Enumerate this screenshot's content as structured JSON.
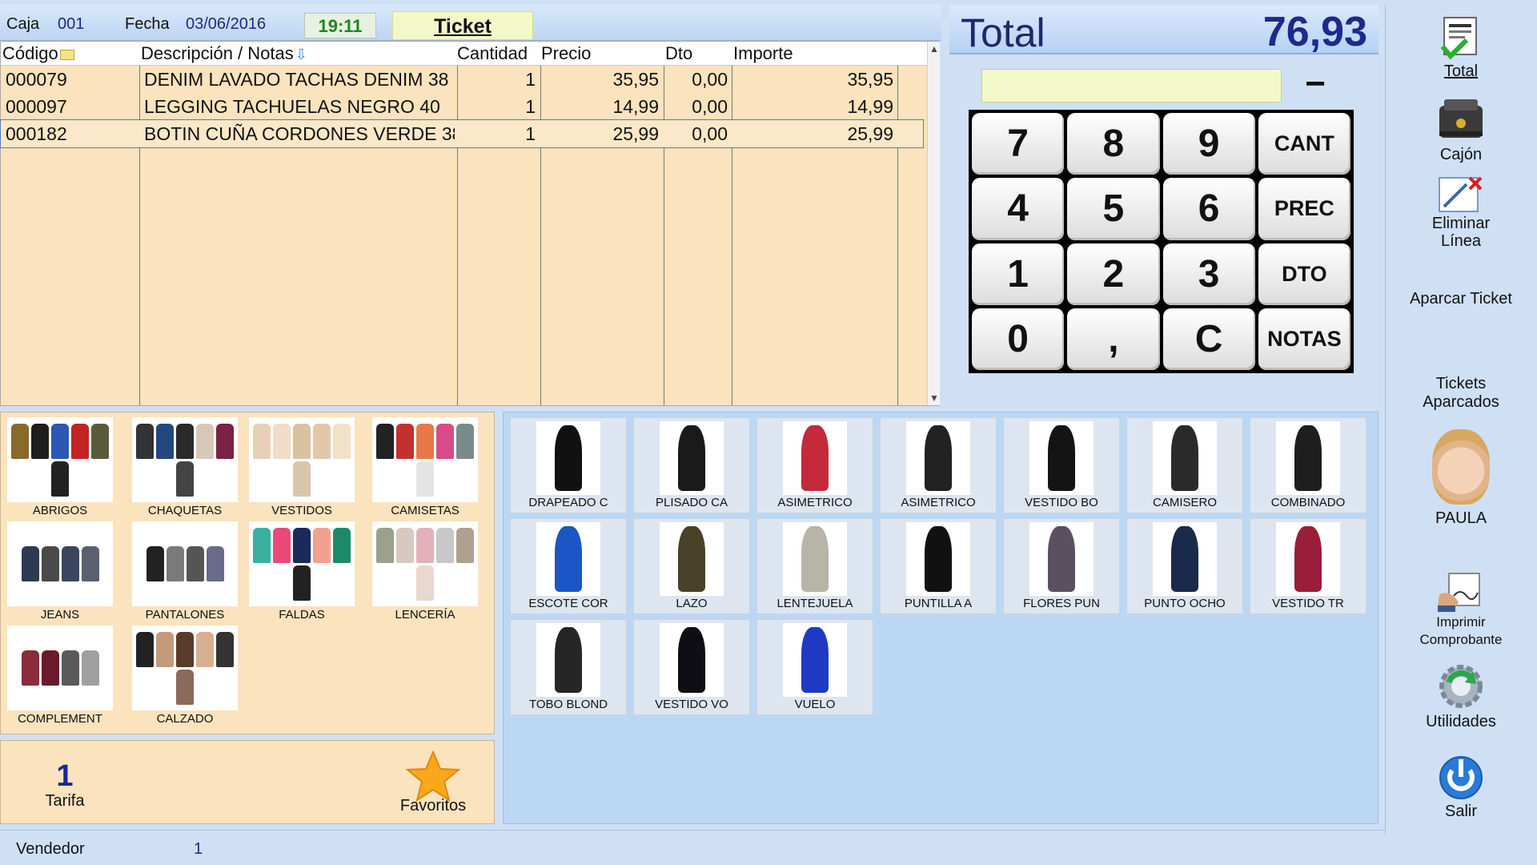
{
  "header": {
    "caja_label": "Caja",
    "caja_value": "001",
    "fecha_label": "Fecha",
    "fecha_value": "03/06/2016",
    "time": "19:11",
    "ticket_label": "Ticket"
  },
  "grid": {
    "columns": [
      "Código",
      "Descripción / Notas",
      "Cantidad",
      "Precio",
      "Dto",
      "Importe"
    ],
    "rows": [
      {
        "codigo": "000079",
        "descripcion": "DENIM LAVADO TACHAS DENIM 38",
        "cantidad": "1",
        "precio": "35,95",
        "dto": "0,00",
        "importe": "35,95"
      },
      {
        "codigo": "000097",
        "descripcion": "LEGGING TACHUELAS NEGRO 40",
        "cantidad": "1",
        "precio": "14,99",
        "dto": "0,00",
        "importe": "14,99"
      },
      {
        "codigo": "000182",
        "descripcion": "BOTIN CUÑA CORDONES VERDE 38",
        "cantidad": "1",
        "precio": "25,99",
        "dto": "0,00",
        "importe": "25,99"
      }
    ]
  },
  "total": {
    "label": "Total",
    "value": "76,93"
  },
  "keypad": {
    "minus": "−",
    "keys": [
      "7",
      "8",
      "9",
      "CANT",
      "4",
      "5",
      "6",
      "PREC",
      "1",
      "2",
      "3",
      "DTO",
      "0",
      ",",
      "C",
      "NOTAS"
    ]
  },
  "sidebar": {
    "total": "Total",
    "cajon": "Cajón",
    "eliminar_1": "Eliminar",
    "eliminar_2": "Línea",
    "aparcar": "Aparcar Ticket",
    "aparcados_1": "Tickets",
    "aparcados_2": "Aparcados",
    "user": "PAULA",
    "imprimir_1": "Imprimir",
    "imprimir_2": "Comprobante",
    "utilidades": "Utilidades",
    "salir": "Salir"
  },
  "categories": [
    {
      "label": "ABRIGOS",
      "colors": [
        "#8a6a2a",
        "#1e1e1e",
        "#2c57b4",
        "#c22424",
        "#5a5a3a",
        "#222"
      ]
    },
    {
      "label": "CHAQUETAS",
      "colors": [
        "#333",
        "#23477d",
        "#2a2a2a",
        "#d8c8b8",
        "#7a2244",
        "#444"
      ]
    },
    {
      "label": "VESTIDOS",
      "colors": [
        "#e8d0b8",
        "#f0dcc8",
        "#d9c2a0",
        "#e2c8a8",
        "#f1e1c9",
        "#d8c6a8"
      ]
    },
    {
      "label": "CAMISETAS",
      "colors": [
        "#222",
        "#c43030",
        "#e8774a",
        "#d84a8a",
        "#7a8a8a",
        "#e4e4e4"
      ]
    },
    {
      "label": "JEANS",
      "colors": [
        "#2e3a52",
        "#4a4a4a",
        "#3a4660",
        "#5a6070"
      ]
    },
    {
      "label": "PANTALONES",
      "colors": [
        "#222",
        "#7a7a7a",
        "#555",
        "#6a6a8a"
      ]
    },
    {
      "label": "FALDAS",
      "colors": [
        "#38b0a0",
        "#e84a7a",
        "#1a2a5a",
        "#f2a090",
        "#1a8a6a",
        "#222"
      ]
    },
    {
      "label": "LENCERÍA",
      "colors": [
        "#9aa08a",
        "#d8c8c0",
        "#e2b0b8",
        "#c8c8c8",
        "#b0a090",
        "#e8d8d0"
      ]
    },
    {
      "label": "COMPLEMENT",
      "colors": [
        "#8a2a3a",
        "#6a1a2a",
        "#5a5a5a",
        "#a0a0a0"
      ]
    },
    {
      "label": "CALZADO",
      "colors": [
        "#222",
        "#c49a7a",
        "#5a3a2a",
        "#d8b090",
        "#333",
        "#8a6a5a"
      ]
    }
  ],
  "products": [
    {
      "label": "DRAPEADO C",
      "color": "#111"
    },
    {
      "label": "PLISADO CA",
      "color": "#1a1a1a"
    },
    {
      "label": "ASIMETRICO",
      "color": "#c42a3a"
    },
    {
      "label": "ASIMETRICO",
      "color": "#222"
    },
    {
      "label": "VESTIDO BO",
      "color": "#141414"
    },
    {
      "label": "CAMISERO",
      "color": "#2a2a2a"
    },
    {
      "label": "COMBINADO",
      "color": "#1e1e1e"
    },
    {
      "label": "ESCOTE COR",
      "color": "#1a56c4"
    },
    {
      "label": "LAZO",
      "color": "#4a4228"
    },
    {
      "label": "LENTEJUELA",
      "color": "#b8b4a8"
    },
    {
      "label": "PUNTILLA A",
      "color": "#111"
    },
    {
      "label": "FLORES PUN",
      "color": "#5a5060"
    },
    {
      "label": "PUNTO OCHO",
      "color": "#1a2a4a"
    },
    {
      "label": "VESTIDO TR",
      "color": "#9a1e3a"
    },
    {
      "label": "TOBO BLOND",
      "color": "#262626"
    },
    {
      "label": "VESTIDO VO",
      "color": "#0e0e14"
    },
    {
      "label": "VUELO",
      "color": "#1e3ac4"
    }
  ],
  "tarifa": {
    "number": "1",
    "label": "Tarifa",
    "favoritos": "Favoritos"
  },
  "status": {
    "vendedor_label": "Vendedor",
    "vendedor_value": "1"
  }
}
